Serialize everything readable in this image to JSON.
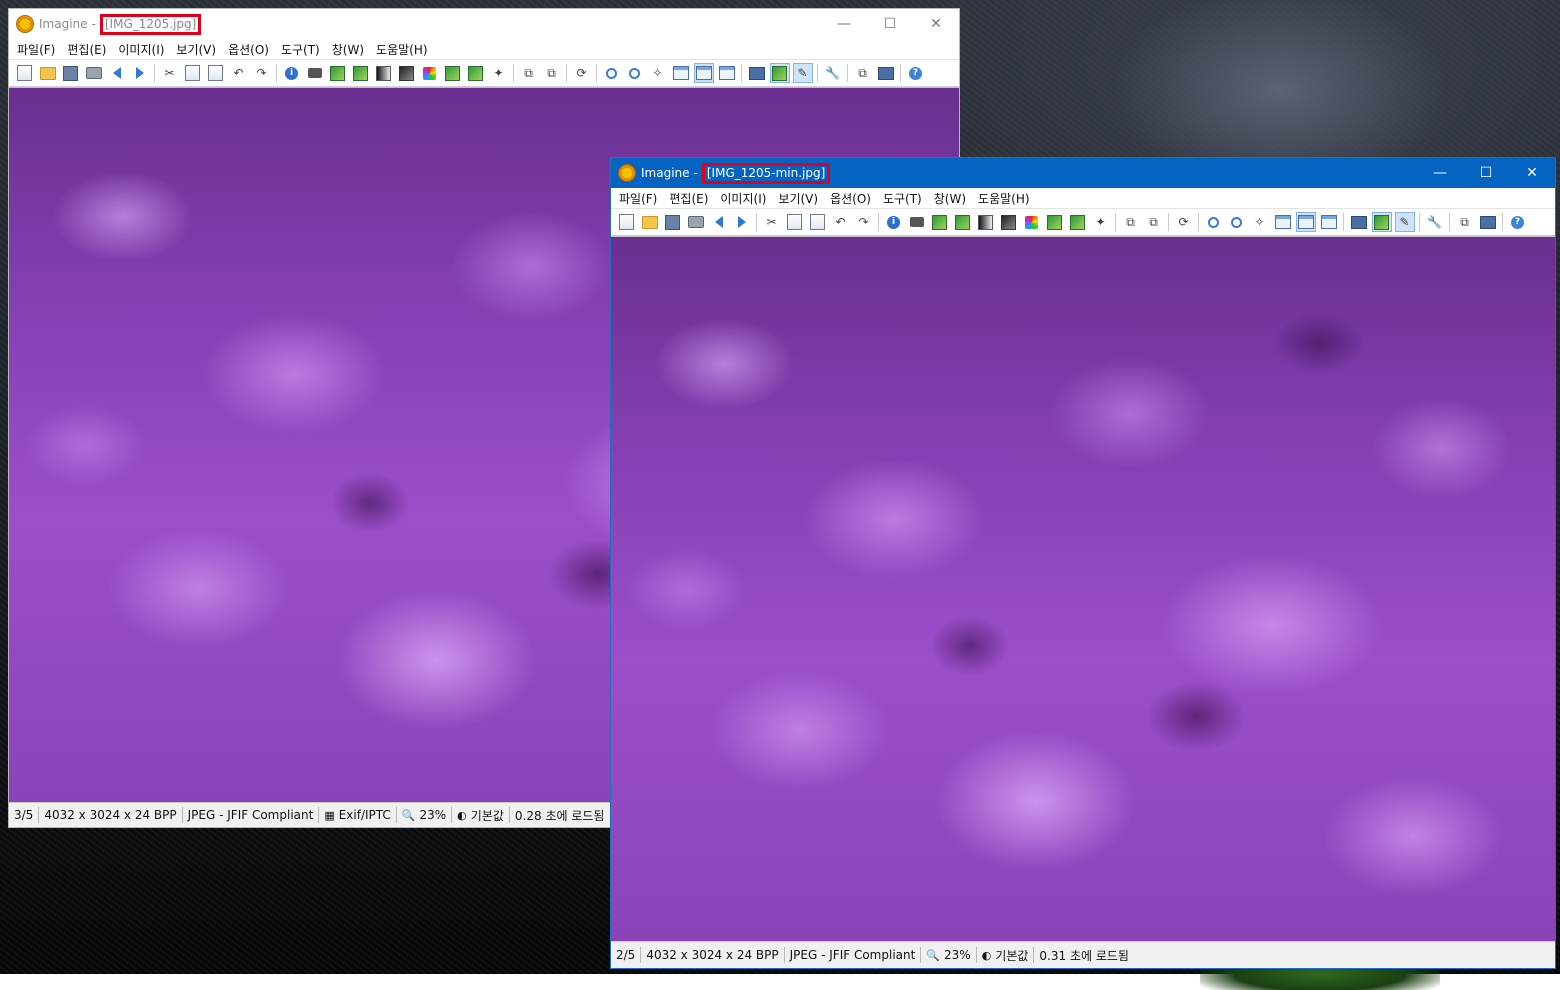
{
  "back_window": {
    "app_name": "Imagine",
    "separator": "-",
    "file_title": "[IMG_1205.jpg]",
    "menus": [
      "파일(F)",
      "편집(E)",
      "이미지(I)",
      "보기(V)",
      "옵션(O)",
      "도구(T)",
      "창(W)",
      "도움말(H)"
    ],
    "status": {
      "index": "3/5",
      "dimensions": "4032 x 3024 x 24 BPP",
      "format": "JPEG - JFIF Compliant",
      "exif": "Exif/IPTC",
      "zoom": "23%",
      "mode": "기본값",
      "load_time": "0.28 초에 로드됨"
    }
  },
  "front_window": {
    "app_name": "Imagine",
    "separator": "-",
    "file_title": "[IMG_1205-min.jpg]",
    "menus": [
      "파일(F)",
      "편집(E)",
      "이미지(I)",
      "보기(V)",
      "옵션(O)",
      "도구(T)",
      "창(W)",
      "도움말(H)"
    ],
    "status": {
      "index": "2/5",
      "dimensions": "4032 x 3024 x 24 BPP",
      "format": "JPEG - JFIF Compliant",
      "zoom": "23%",
      "mode": "기본값",
      "load_time": "0.31 초에 로드됨"
    }
  },
  "window_controls": {
    "minimize": "—",
    "maximize": "☐",
    "close": "✕"
  },
  "colors": {
    "active_title": "#0563c1",
    "highlight_box": "#e0001a"
  }
}
